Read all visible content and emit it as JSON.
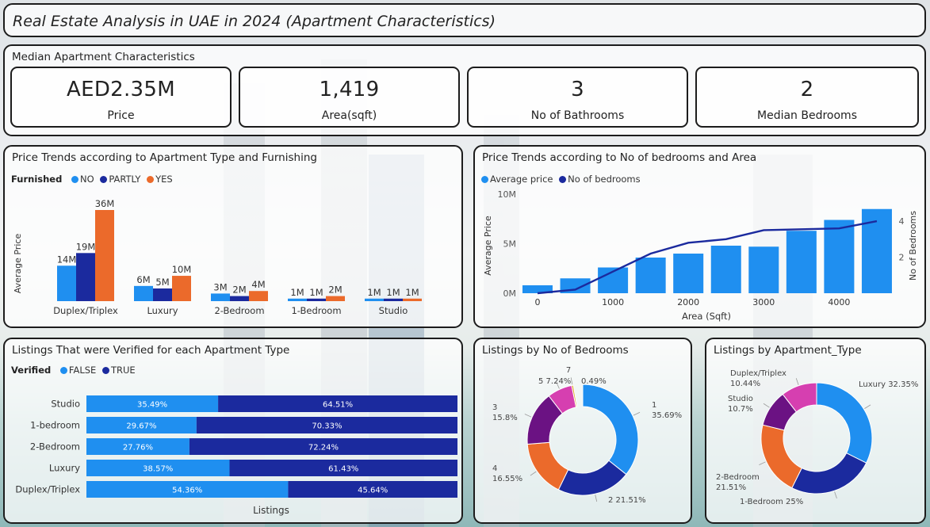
{
  "title": "Real Estate Analysis in UAE in 2024 (Apartment Characteristics)",
  "kpi_section": {
    "title": "Median Apartment Characteristics",
    "cards": [
      {
        "value": "AED2.35M",
        "label": "Price"
      },
      {
        "value": "1,419",
        "label": "Area(sqft)"
      },
      {
        "value": "3",
        "label": "No of Bathrooms"
      },
      {
        "value": "2",
        "label": "Median Bedrooms"
      }
    ]
  },
  "colors": {
    "no": "#1f8ff0",
    "partly": "#1b2a9e",
    "yes": "#eb6a2b",
    "false": "#1f8ff0",
    "true": "#1b2a9e",
    "bar": "#1f8ff0",
    "line": "#1b2a9e",
    "pie_magenta": "#d63fb0",
    "pie_purple": "#6b1283",
    "pie_gold": "#d9a21b"
  },
  "charts": {
    "furnishing": {
      "title": "Price Trends according to Apartment Type and Furnishing",
      "legend_title": "Furnished",
      "legend": [
        "NO",
        "PARTLY",
        "YES"
      ]
    },
    "bedrooms_area": {
      "title": "Price Trends according to No of bedrooms and Area",
      "legend": [
        "Average price",
        "No of bedrooms"
      ]
    },
    "verified": {
      "title": "Listings That were Verified for each Apartment Type",
      "legend_title": "Verified",
      "legend": [
        "FALSE",
        "TRUE"
      ]
    },
    "bedroom_pie": {
      "title": "Listings by No of Bedrooms"
    },
    "type_pie": {
      "title": "Listings by Apartment_Type"
    }
  },
  "chart_data": [
    {
      "type": "bar",
      "title": "Price Trends according to Apartment Type and Furnishing",
      "ylabel": "Average Price",
      "categories": [
        "Duplex/Triplex",
        "Luxury",
        "2-Bedroom",
        "1-Bedroom",
        "Studio"
      ],
      "series": [
        {
          "name": "NO",
          "values": [
            14,
            6,
            3,
            1,
            1
          ],
          "labels": [
            "14M",
            "6M",
            "3M",
            "1M",
            "1M"
          ]
        },
        {
          "name": "PARTLY",
          "values": [
            19,
            5,
            2,
            1,
            1
          ],
          "labels": [
            "19M",
            "5M",
            "2M",
            "1M",
            "1M"
          ]
        },
        {
          "name": "YES",
          "values": [
            36,
            10,
            4,
            2,
            1
          ],
          "labels": [
            "36M",
            "10M",
            "4M",
            "2M",
            "1M"
          ]
        }
      ]
    },
    {
      "type": "bar",
      "title": "Price Trends according to No of bedrooms and Area",
      "xlabel": "Area (Sqft)",
      "ylabel": "Average Price",
      "y2label": "No of Bedrooms",
      "x": [
        0,
        500,
        1000,
        1500,
        2000,
        2500,
        3000,
        3500,
        4000,
        4500
      ],
      "xticks": [
        "0",
        "1000",
        "2000",
        "3000",
        "4000"
      ],
      "yticks": [
        "0M",
        "5M",
        "10M"
      ],
      "y2ticks": [
        "2",
        "4"
      ],
      "ylim": [
        0,
        10
      ],
      "y2lim": [
        0,
        5.5
      ],
      "series": [
        {
          "name": "Average price",
          "values": [
            0.8,
            1.5,
            2.6,
            3.6,
            4.0,
            4.8,
            4.7,
            6.3,
            7.4,
            8.5
          ]
        },
        {
          "name": "No of bedrooms",
          "values": [
            0,
            0.2,
            1.2,
            2.2,
            2.8,
            3.0,
            3.5,
            3.55,
            3.6,
            4.0
          ]
        }
      ]
    },
    {
      "type": "bar",
      "title": "Listings That were Verified for each Apartment Type",
      "xlabel": "Listings",
      "categories": [
        "Studio",
        "1-bedroom",
        "2-Bedroom",
        "Luxury",
        "Duplex/Triplex"
      ],
      "series": [
        {
          "name": "FALSE",
          "values": [
            35.49,
            29.67,
            27.76,
            38.57,
            54.36
          ]
        },
        {
          "name": "TRUE",
          "values": [
            64.51,
            70.33,
            72.24,
            61.43,
            45.64
          ]
        }
      ]
    },
    {
      "type": "pie",
      "title": "Listings by No of Bedrooms",
      "slices": [
        {
          "label": "1",
          "value": 35.69,
          "text": "35.69%"
        },
        {
          "label": "2",
          "value": 21.51,
          "text": "21.51%"
        },
        {
          "label": "4",
          "value": 16.55,
          "text": "16.55%"
        },
        {
          "label": "3",
          "value": 15.8,
          "text": "15.8%"
        },
        {
          "label": "5",
          "value": 7.24,
          "text": "7.24%"
        },
        {
          "label": "7",
          "value": 0.49,
          "text": "0.49%"
        }
      ]
    },
    {
      "type": "pie",
      "title": "Listings by Apartment_Type",
      "slices": [
        {
          "label": "Luxury",
          "value": 32.35,
          "text": "32.35%"
        },
        {
          "label": "1-Bedroom",
          "value": 25,
          "text": "25%"
        },
        {
          "label": "2-Bedroom",
          "value": 21.51,
          "text": "21.51%"
        },
        {
          "label": "Studio",
          "value": 10.7,
          "text": "10.7%"
        },
        {
          "label": "Duplex/Triplex",
          "value": 10.44,
          "text": "10.44%"
        }
      ]
    }
  ]
}
